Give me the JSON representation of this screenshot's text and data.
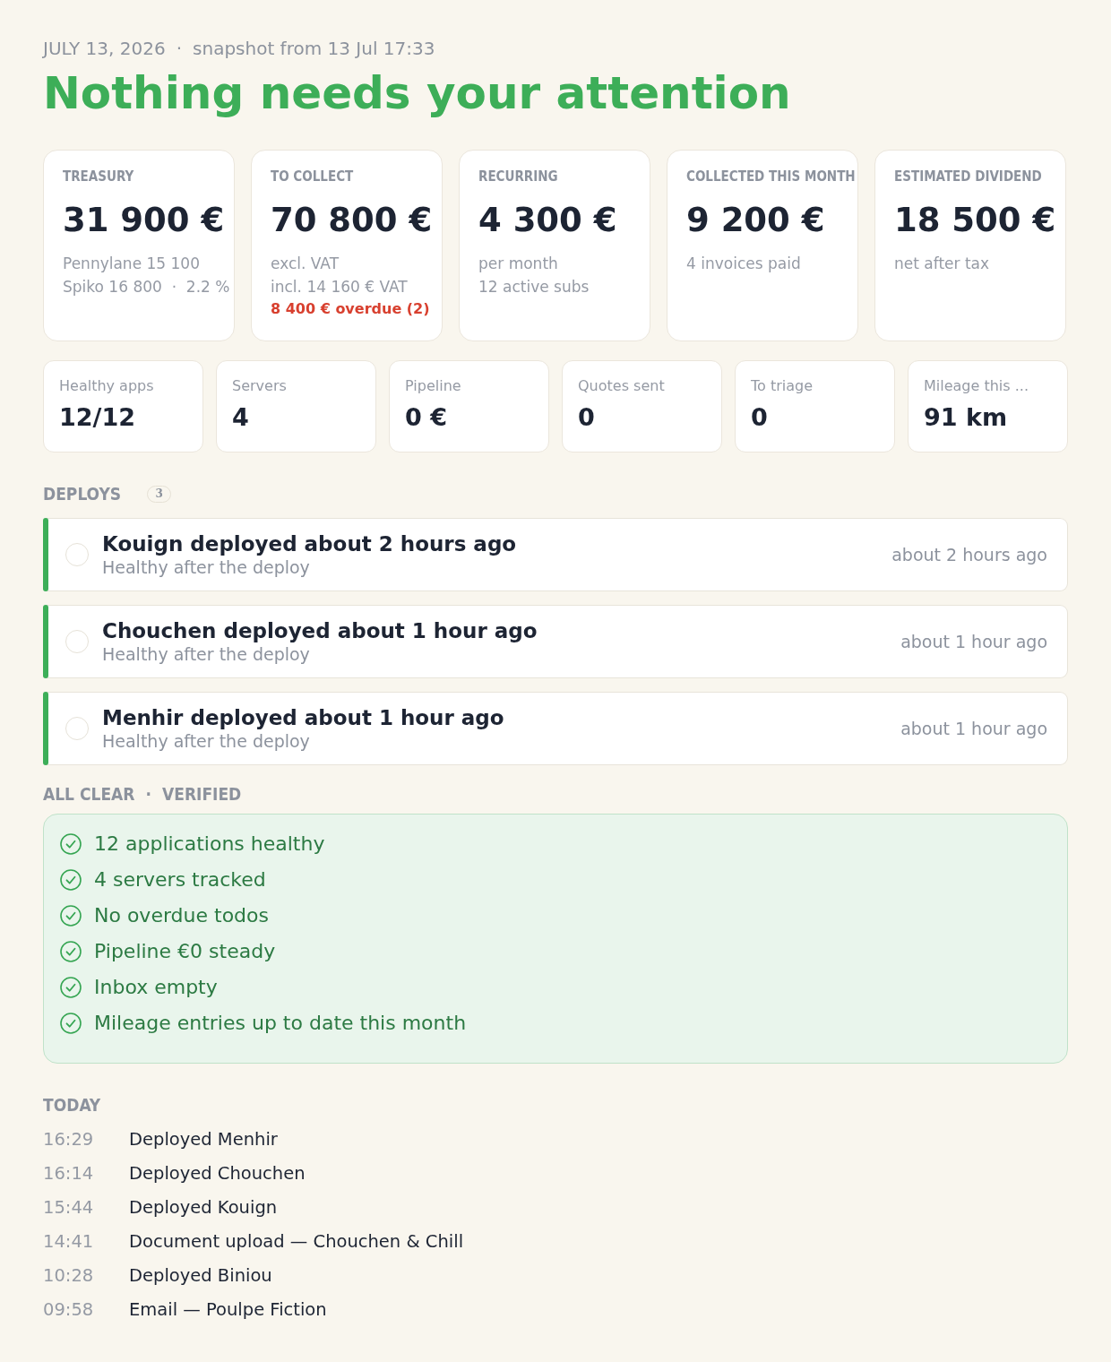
{
  "header": {
    "date": "JULY 13, 2026",
    "separator": "·",
    "snapshot": "snapshot from 13 Jul 17:33",
    "title": "Nothing needs your attention"
  },
  "kpi_cards": [
    {
      "label": "TREASURY",
      "value": "31 900 €",
      "notes": [
        {
          "kind": "muted",
          "text": "Pennylane 15 100"
        },
        {
          "kind": "muted",
          "text": "Spiko 16 800  ·  2.2 %"
        }
      ]
    },
    {
      "label": "TO COLLECT",
      "value": "70 800 €",
      "notes": [
        {
          "kind": "muted",
          "text": "excl. VAT"
        },
        {
          "kind": "muted",
          "text": "incl. 14 160 € VAT"
        },
        {
          "kind": "alert",
          "text": "8 400 € overdue (2)"
        }
      ]
    },
    {
      "label": "RECURRING",
      "value": "4 300 €",
      "notes": [
        {
          "kind": "muted",
          "text": "per month"
        },
        {
          "kind": "muted",
          "text": "12 active subs"
        }
      ]
    },
    {
      "label": "COLLECTED THIS MONTH",
      "value": "9 200 €",
      "notes": [
        {
          "kind": "muted",
          "text": "4 invoices paid"
        }
      ]
    },
    {
      "label": "ESTIMATED DIVIDEND",
      "value": "18 500 €",
      "notes": [
        {
          "kind": "muted",
          "text": "net after tax"
        }
      ]
    }
  ],
  "stats": [
    {
      "label": "Healthy apps",
      "value": "12/12"
    },
    {
      "label": "Servers",
      "value": "4"
    },
    {
      "label": "Pipeline",
      "value": "0 €"
    },
    {
      "label": "Quotes sent",
      "value": "0"
    },
    {
      "label": "To triage",
      "value": "0"
    },
    {
      "label": "Mileage this ...",
      "value": "91 km"
    }
  ],
  "deploys": {
    "title": "DEPLOYS",
    "count": "3",
    "items": [
      {
        "title": "Kouign deployed about 2 hours ago",
        "subtitle": "Healthy after the deploy",
        "time": "about 2 hours ago",
        "color": "#3dae58",
        "checked": false
      },
      {
        "title": "Chouchen deployed about 1 hour ago",
        "subtitle": "Healthy after the deploy",
        "time": "about 1 hour ago",
        "color": "#3dae58",
        "checked": false
      },
      {
        "title": "Menhir deployed about 1 hour ago",
        "subtitle": "Healthy after the deploy",
        "time": "about 1 hour ago",
        "color": "#3dae58",
        "checked": false
      }
    ]
  },
  "all_clear": {
    "title": "ALL CLEAR",
    "separator": "·",
    "subtitle": "VERIFIED",
    "items": [
      "12 applications healthy",
      "4 servers tracked",
      "No overdue todos",
      "Pipeline €0 steady",
      "Inbox empty",
      "Mileage entries up to date this month"
    ]
  },
  "today": {
    "title": "TODAY",
    "events": [
      {
        "time": "16:29",
        "text": "Deployed Menhir"
      },
      {
        "time": "16:14",
        "text": "Deployed Chouchen"
      },
      {
        "time": "15:44",
        "text": "Deployed Kouign"
      },
      {
        "time": "14:41",
        "text": "Document upload — Chouchen & Chill"
      },
      {
        "time": "10:28",
        "text": "Deployed Biniou"
      },
      {
        "time": "09:58",
        "text": "Email — Poulpe Fiction"
      }
    ]
  }
}
